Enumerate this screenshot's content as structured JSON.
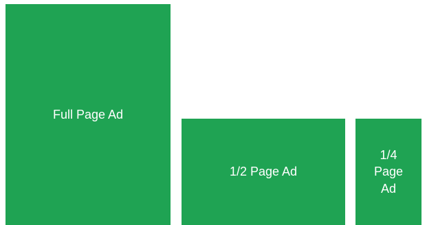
{
  "colors": {
    "ad_block_fill": "#1fa353",
    "ad_label_text": "#ffffff",
    "background": "#ffffff"
  },
  "ads": {
    "full": {
      "label": "Full Page Ad"
    },
    "half": {
      "label": "1/2 Page Ad"
    },
    "quarter": {
      "label": "1/4\nPage\nAd"
    }
  }
}
